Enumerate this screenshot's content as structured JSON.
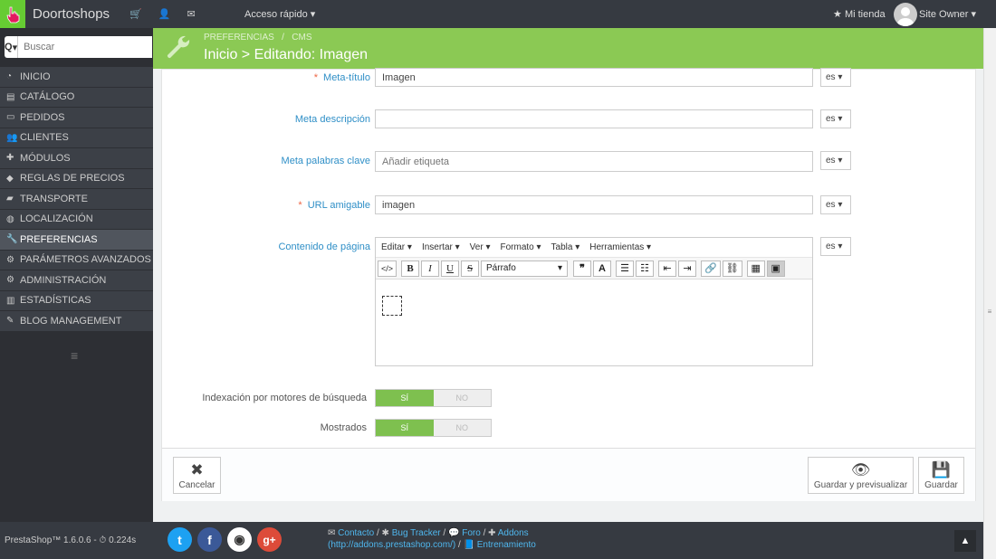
{
  "topbar": {
    "shop_name": "Doortoshops",
    "quick_access": "Acceso rápido",
    "my_shop": "Mi tienda",
    "user": "Site Owner"
  },
  "sidebar": {
    "search_placeholder": "Buscar",
    "search_btn": "Q",
    "items": [
      {
        "label": "INICIO",
        "icon": "tachometer-icon"
      },
      {
        "label": "CATÁLOGO",
        "icon": "book-icon"
      },
      {
        "label": "PEDIDOS",
        "icon": "credit-card-icon"
      },
      {
        "label": "CLIENTES",
        "icon": "users-icon"
      },
      {
        "label": "MÓDULOS",
        "icon": "puzzle-icon"
      },
      {
        "label": "REGLAS DE PRECIOS",
        "icon": "tags-icon"
      },
      {
        "label": "TRANSPORTE",
        "icon": "truck-icon"
      },
      {
        "label": "LOCALIZACIÓN",
        "icon": "globe-icon"
      },
      {
        "label": "PREFERENCIAS",
        "icon": "wrench-icon"
      },
      {
        "label": "PARÁMETROS AVANZADOS",
        "icon": "cogs-icon"
      },
      {
        "label": "ADMINISTRACIÓN",
        "icon": "cog-icon"
      },
      {
        "label": "ESTADÍSTICAS",
        "icon": "bar-chart-icon"
      },
      {
        "label": "BLOG MANAGEMENT",
        "icon": "pencil-icon"
      }
    ]
  },
  "header": {
    "bc1": "PREFERENCIAS",
    "bc_sep": "/",
    "bc2": "CMS",
    "title": "Inicio > Editando: Imagen"
  },
  "form": {
    "req_mark": "*",
    "meta_title_label": "Meta-título",
    "meta_title_value": "Imagen",
    "meta_desc_label": "Meta descripción",
    "meta_desc_value": "",
    "meta_kw_label": "Meta palabras clave",
    "meta_kw_placeholder": "Añadir etiqueta",
    "url_label": "URL amigable",
    "url_value": "imagen",
    "content_label": "Contenido de página",
    "lang": "es",
    "indexing_label": "Indexación por motores de búsqueda",
    "shown_label": "Mostrados",
    "yes": "SÍ",
    "no": "NO"
  },
  "editor": {
    "menus": [
      "Editar",
      "Insertar",
      "Ver",
      "Formato",
      "Tabla",
      "Herramientas"
    ],
    "format": "Párrafo",
    "b": "B",
    "i": "I",
    "u": "U",
    "s": "S",
    "code": "</>",
    "quote": "❞",
    "a": "A"
  },
  "buttons": {
    "cancel": "Cancelar",
    "save_preview": "Guardar y previsualizar",
    "save": "Guardar"
  },
  "footer": {
    "version": "PrestaShop™ 1.6.0.6 -",
    "time": "0.224s",
    "contact": "Contacto",
    "bug": "Bug Tracker",
    "forum": "Foro",
    "addons": "Addons",
    "addons_url": "(http://addons.prestashop.com/)",
    "training": "Entrenamiento",
    "sep": "/"
  }
}
